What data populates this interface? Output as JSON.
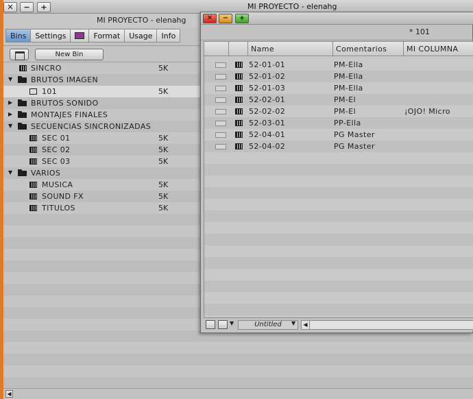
{
  "project_window": {
    "title": "MI PROYECTO - elenahg",
    "header_name": "MI PROYECTO - elenahg",
    "titlebar_buttons": [
      "✕",
      "−",
      "+"
    ],
    "tabs": [
      {
        "label": "Bins",
        "active": true
      },
      {
        "label": "Settings",
        "active": false
      },
      {
        "label": "",
        "active": false,
        "swatch_color": "#8e3a8e"
      },
      {
        "label": "Format",
        "active": false
      },
      {
        "label": "Usage",
        "active": false
      },
      {
        "label": "Info",
        "active": false
      }
    ],
    "new_bin_label": "New Bin",
    "tree": [
      {
        "label": "SINCRO",
        "size": "5K",
        "level": 0,
        "kind": "bin"
      },
      {
        "label": "BRUTOS IMAGEN",
        "size": "",
        "level": 0,
        "kind": "folder-open"
      },
      {
        "label": "101",
        "size": "5K",
        "level": 1,
        "kind": "bin-open",
        "selected": true
      },
      {
        "label": "BRUTOS SONIDO",
        "size": "",
        "level": 0,
        "kind": "folder-closed"
      },
      {
        "label": "MONTAJES FINALES",
        "size": "",
        "level": 0,
        "kind": "folder-closed"
      },
      {
        "label": "SECUENCIAS SINCRONIZADAS",
        "size": "",
        "level": 0,
        "kind": "folder-open"
      },
      {
        "label": "SEC 01",
        "size": "5K",
        "level": 1,
        "kind": "bin"
      },
      {
        "label": "SEC 02",
        "size": "5K",
        "level": 1,
        "kind": "bin"
      },
      {
        "label": "SEC 03",
        "size": "5K",
        "level": 1,
        "kind": "bin"
      },
      {
        "label": "VARIOS",
        "size": "",
        "level": 0,
        "kind": "folder-open"
      },
      {
        "label": "MUSICA",
        "size": "5K",
        "level": 1,
        "kind": "bin"
      },
      {
        "label": "SOUND FX",
        "size": "5K",
        "level": 1,
        "kind": "bin"
      },
      {
        "label": "TITULOS",
        "size": "5K",
        "level": 1,
        "kind": "bin"
      }
    ]
  },
  "bin_window": {
    "name": "* 101",
    "columns": [
      "Name",
      "Comentarios",
      "MI COLUMNA"
    ],
    "clips": [
      {
        "name": "52-01-01",
        "comentarios": "PM-Ella",
        "mi_columna": ""
      },
      {
        "name": "52-01-02",
        "comentarios": "PM-Ella",
        "mi_columna": ""
      },
      {
        "name": "52-01-03",
        "comentarios": "PM-Ella",
        "mi_columna": ""
      },
      {
        "name": "52-02-01",
        "comentarios": "PM-El",
        "mi_columna": ""
      },
      {
        "name": "52-02-02",
        "comentarios": "PM-El",
        "mi_columna": "¡OJO! Micro"
      },
      {
        "name": "52-03-01",
        "comentarios": "PP-Ella",
        "mi_columna": ""
      },
      {
        "name": "52-04-01",
        "comentarios": "PG Master",
        "mi_columna": ""
      },
      {
        "name": "52-04-02",
        "comentarios": "PG Master",
        "mi_columna": ""
      }
    ],
    "view_menu": "Untitled"
  }
}
